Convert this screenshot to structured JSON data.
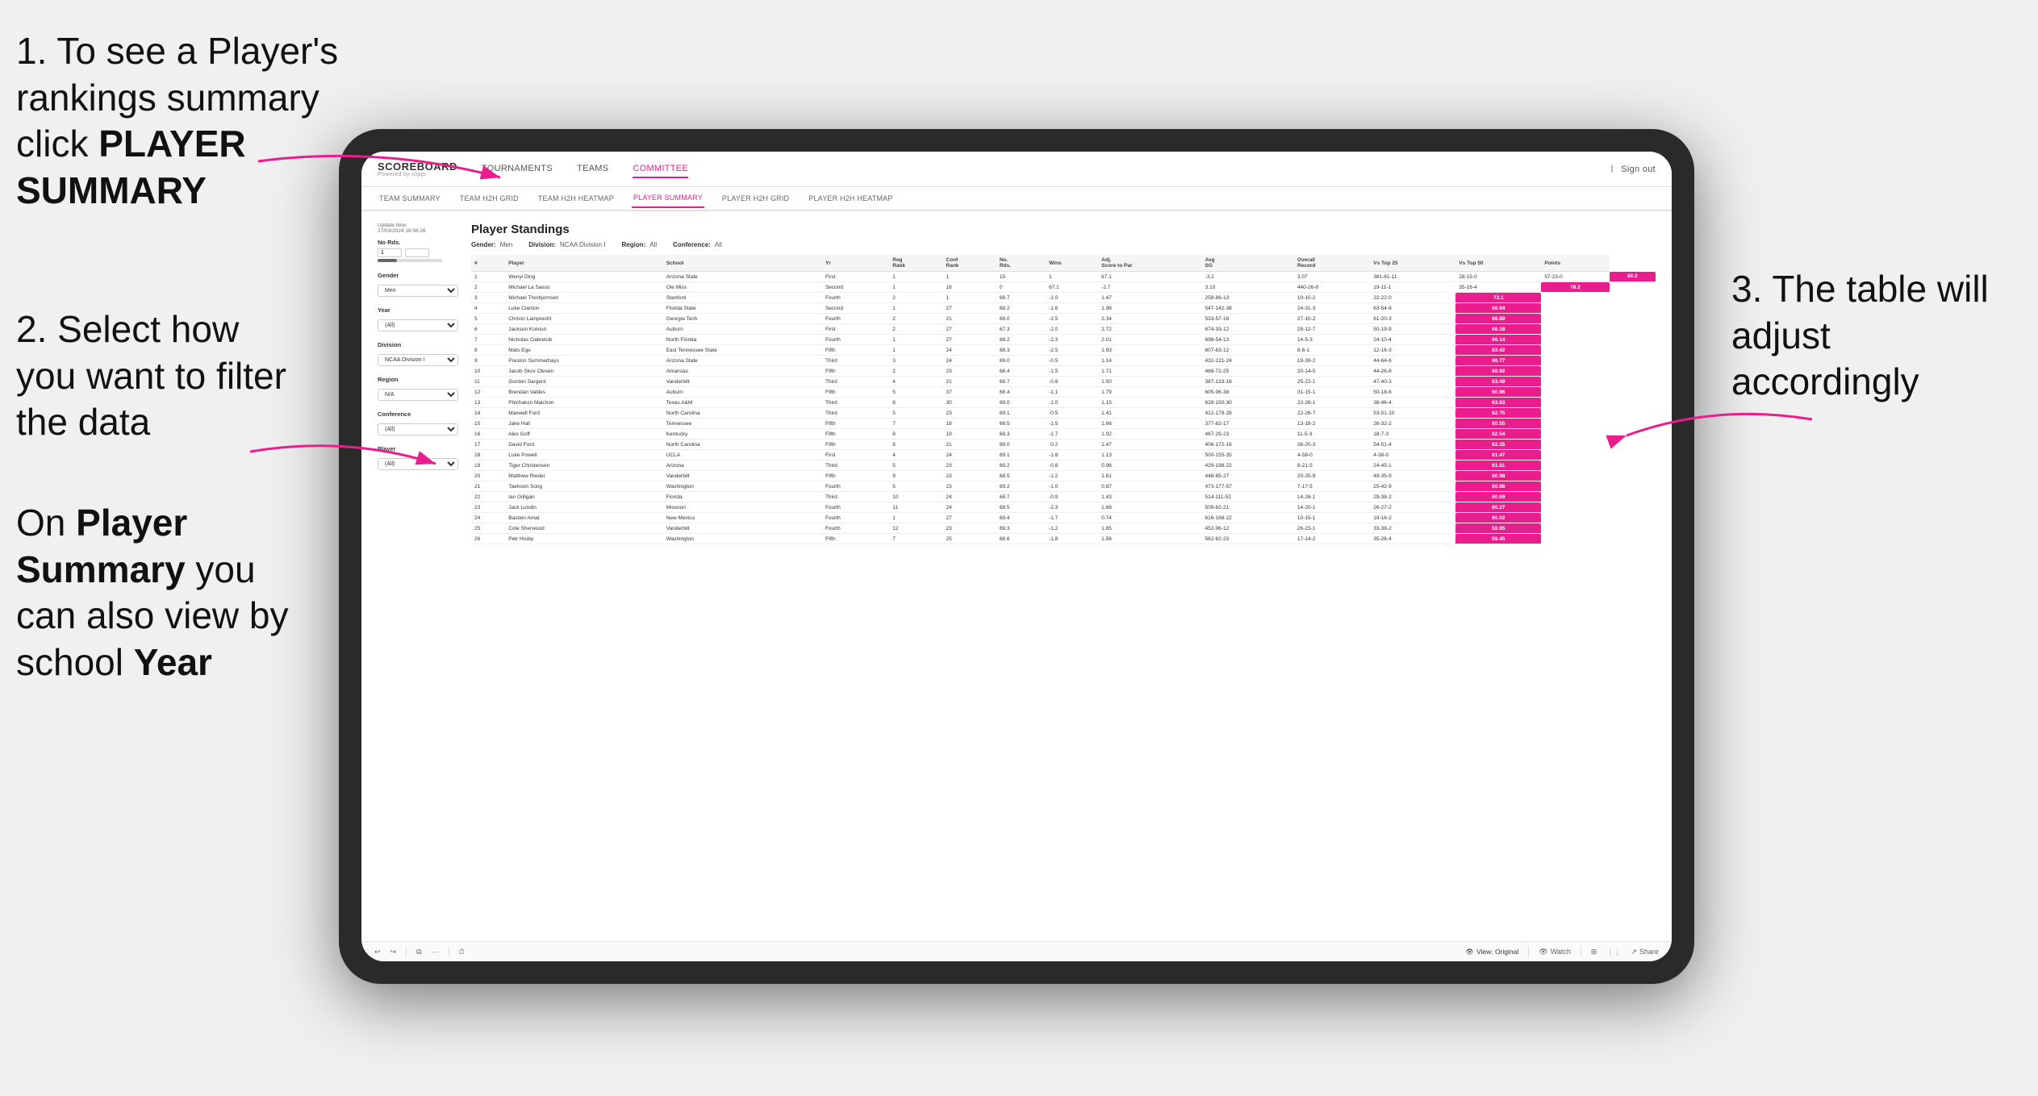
{
  "instructions": {
    "step1": {
      "text": "1. To see a Player's rankings summary click ",
      "bold": "PLAYER SUMMARY"
    },
    "step2": {
      "text": "2. Select how you want to filter the data"
    },
    "step3": {
      "text": "3. The table will adjust accordingly"
    },
    "step4_prefix": "On ",
    "step4_bold1": "Player Summary",
    "step4_middle": " you can also view by school ",
    "step4_bold2": "Year"
  },
  "app": {
    "logo_main": "SCOREBOARD",
    "logo_sub": "Powered by clippi",
    "sign_out": "Sign out"
  },
  "nav": {
    "items": [
      {
        "label": "TOURNAMENTS",
        "active": false
      },
      {
        "label": "TEAMS",
        "active": false
      },
      {
        "label": "COMMITTEE",
        "active": true
      }
    ]
  },
  "sub_nav": {
    "items": [
      {
        "label": "TEAM SUMMARY",
        "active": false
      },
      {
        "label": "TEAM H2H GRID",
        "active": false
      },
      {
        "label": "TEAM H2H HEATMAP",
        "active": false
      },
      {
        "label": "PLAYER SUMMARY",
        "active": true
      },
      {
        "label": "PLAYER H2H GRID",
        "active": false
      },
      {
        "label": "PLAYER H2H HEATMAP",
        "active": false
      }
    ]
  },
  "sidebar": {
    "update_label": "Update time:",
    "update_time": "27/03/2024 16:56:26",
    "no_rds_label": "No Rds.",
    "gender_label": "Gender",
    "gender_value": "Men",
    "year_label": "Year",
    "year_value": "(All)",
    "division_label": "Division",
    "division_value": "NCAA Division I",
    "region_label": "Region",
    "region_value": "N/A",
    "conference_label": "Conference",
    "conference_value": "(All)",
    "player_label": "Player",
    "player_value": "(All)"
  },
  "table": {
    "title": "Player Standings",
    "filters": {
      "gender_label": "Gender:",
      "gender_value": "Men",
      "division_label": "Division:",
      "division_value": "NCAA Division I",
      "region_label": "Region:",
      "region_value": "All",
      "conference_label": "Conference:",
      "conference_value": "All"
    },
    "headers": [
      "#",
      "Player",
      "School",
      "Yr",
      "Reg Rank",
      "Conf Rank",
      "No. Rds.",
      "Wins",
      "Adj. Score to Par",
      "Avg SG",
      "Overall Record",
      "Vs Top 25",
      "Vs Top 50",
      "Points"
    ],
    "rows": [
      [
        "1",
        "Wenyi Ding",
        "Arizona State",
        "First",
        "1",
        "1",
        "15",
        "1",
        "67.1",
        "-3.2",
        "3.07",
        "381-61-11",
        "28-15-0",
        "57-23-0",
        "88.2"
      ],
      [
        "2",
        "Michael La Sasso",
        "Ole Miss",
        "Second",
        "1",
        "18",
        "0",
        "67.1",
        "-2.7",
        "3.10",
        "440-26-6",
        "19-11-1",
        "35-16-4",
        "78.2"
      ],
      [
        "3",
        "Michael Thorbjornsen",
        "Stanford",
        "Fourth",
        "2",
        "1",
        "68.7",
        "-2.0",
        "1.47",
        "258-86-13",
        "10-10-2",
        "22-22-0",
        "73.1"
      ],
      [
        "4",
        "Luke Clanton",
        "Florida State",
        "Second",
        "1",
        "27",
        "68.2",
        "-1.6",
        "1.98",
        "547-142-38",
        "24-31-3",
        "63-54-6",
        "68.04"
      ],
      [
        "5",
        "Christo Lamprecht",
        "Georgia Tech",
        "Fourth",
        "2",
        "21",
        "68.0",
        "-2.5",
        "2.34",
        "533-57-16",
        "27-10-2",
        "61-20-3",
        "68.89"
      ],
      [
        "6",
        "Jackson Koiviun",
        "Auburn",
        "First",
        "2",
        "27",
        "67.3",
        "-2.0",
        "2.72",
        "674-33-12",
        "28-12-7",
        "50-19-9",
        "68.18"
      ],
      [
        "7",
        "Nicholas Gabrelcik",
        "North Florida",
        "Fourth",
        "1",
        "27",
        "68.2",
        "-2.3",
        "2.01",
        "698-54-13",
        "14-5-3",
        "24-10-4",
        "66.14"
      ],
      [
        "8",
        "Mats Ege",
        "East Tennessee State",
        "Fifth",
        "1",
        "24",
        "68.3",
        "-2.5",
        "1.93",
        "607-63-12",
        "8-6-1",
        "12-16-3",
        "83.42"
      ],
      [
        "9",
        "Preston Summerhays",
        "Arizona State",
        "Third",
        "3",
        "24",
        "69.0",
        "-0.5",
        "1.14",
        "432-221-24",
        "19-39-2",
        "44-64-6",
        "66.77"
      ],
      [
        "10",
        "Jacob Skov Olesen",
        "Arkansas",
        "Fifth",
        "2",
        "23",
        "68.4",
        "-1.5",
        "1.71",
        "488-72-25",
        "20-14-5",
        "44-26-8",
        "68.92"
      ],
      [
        "11",
        "Gordon Sargent",
        "Vanderbilt",
        "Third",
        "4",
        "21",
        "68.7",
        "-0.9",
        "1.50",
        "387-133-16",
        "25-22-1",
        "47-40-3",
        "63.49"
      ],
      [
        "12",
        "Brendan Valdes",
        "Auburn",
        "Fifth",
        "5",
        "37",
        "68.4",
        "-1.1",
        "1.79",
        "605-96-38",
        "31-15-1",
        "50-18-6",
        "60.96"
      ],
      [
        "13",
        "Phichaksn Maichon",
        "Texas A&M",
        "Third",
        "6",
        "30",
        "69.0",
        "-1.0",
        "1.15",
        "628-150-30",
        "22-26-1",
        "38-46-4",
        "63.83"
      ],
      [
        "14",
        "Maxwell Ford",
        "North Carolina",
        "Third",
        "5",
        "23",
        "69.1",
        "-0.5",
        "1.41",
        "412-179-28",
        "22-26-7",
        "53-51-10",
        "62.75"
      ],
      [
        "15",
        "Jake Hall",
        "Tennessee",
        "Fifth",
        "7",
        "18",
        "68.5",
        "-1.5",
        "1.66",
        "377-82-17",
        "13-18-2",
        "26-32-2",
        "60.55"
      ],
      [
        "16",
        "Alex Goff",
        "Kentucky",
        "Fifth",
        "8",
        "19",
        "68.3",
        "-1.7",
        "1.92",
        "467-29-23",
        "11-5-3",
        "18-7-3",
        "62.54"
      ],
      [
        "17",
        "David Ford",
        "North Carolina",
        "Fifth",
        "8",
        "21",
        "69.0",
        "-0.2",
        "1.47",
        "406-172-16",
        "26-20-3",
        "54-51-4",
        "62.35"
      ],
      [
        "18",
        "Luke Powell",
        "UCLA",
        "First",
        "4",
        "24",
        "69.1",
        "-1.8",
        "1.13",
        "500-155-35",
        "4-58-0",
        "4-38-0",
        "61.47"
      ],
      [
        "19",
        "Tiger Christensen",
        "Arizona",
        "Third",
        "5",
        "23",
        "69.2",
        "-0.8",
        "0.96",
        "429-198-22",
        "8-21-5",
        "24-45-1",
        "61.81"
      ],
      [
        "20",
        "Matthew Riedel",
        "Vanderbilt",
        "Fifth",
        "9",
        "23",
        "68.5",
        "-1.2",
        "1.61",
        "448-85-27",
        "20-25-9",
        "49-35-9",
        "60.98"
      ],
      [
        "21",
        "Taehoon Song",
        "Washington",
        "Fourth",
        "5",
        "23",
        "69.2",
        "-1.0",
        "0.87",
        "473-177-57",
        "7-17-5",
        "25-42-9",
        "60.98"
      ],
      [
        "22",
        "Ian Gilligan",
        "Florida",
        "Third",
        "10",
        "24",
        "68.7",
        "-0.9",
        "1.43",
        "514-111-52",
        "14-26-1",
        "29-38-2",
        "60.69"
      ],
      [
        "23",
        "Jack Lundin",
        "Missouri",
        "Fourth",
        "11",
        "24",
        "68.5",
        "-2.3",
        "1.68",
        "509-82-21",
        "14-20-1",
        "26-27-2",
        "60.27"
      ],
      [
        "24",
        "Bastien Amat",
        "New Mexico",
        "Fourth",
        "1",
        "27",
        "69.4",
        "-1.7",
        "0.74",
        "616-168-22",
        "10-15-1",
        "19-16-2",
        "60.02"
      ],
      [
        "25",
        "Cole Sherwood",
        "Vanderbilt",
        "Fourth",
        "12",
        "23",
        "69.3",
        "-1.2",
        "1.65",
        "452-96-12",
        "26-23-1",
        "33-38-2",
        "59.95"
      ],
      [
        "26",
        "Petr Hruby",
        "Washington",
        "Fifth",
        "7",
        "25",
        "68.6",
        "-1.8",
        "1.56",
        "562-82-23",
        "17-14-2",
        "35-26-4",
        "59.45"
      ]
    ]
  },
  "toolbar": {
    "view_label": "View: Original",
    "watch_label": "Watch",
    "share_label": "Share"
  }
}
